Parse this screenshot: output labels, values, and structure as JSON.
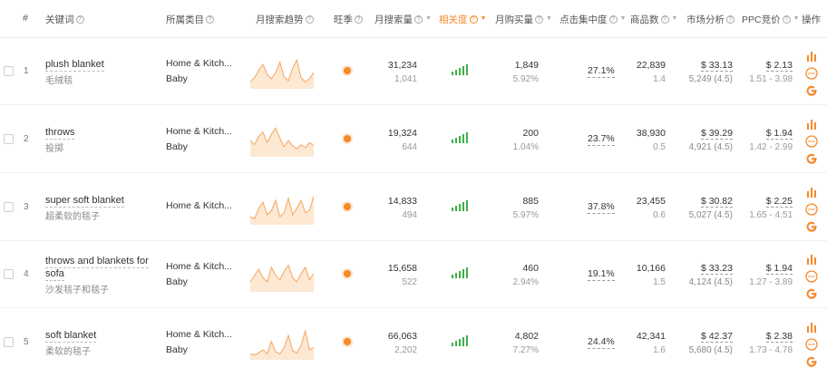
{
  "header": {
    "index": "#",
    "keyword": "关键词",
    "category": "所属类目",
    "trend": "月搜索趋势",
    "peak": "旺季",
    "search_volume": "月搜索量",
    "relevance": "相关度",
    "purchases": "月购买量",
    "click_concentration": "点击集中度",
    "products": "商品数",
    "market": "市场分析",
    "ppc": "PPC竞价",
    "ops": "操作"
  },
  "colors": {
    "accent": "#f5892b",
    "green": "#3db04b",
    "trend_fill": "#fde8d4"
  },
  "icons": {
    "analysis": "bar-chart-icon",
    "more": "ellipsis-circle-icon",
    "google": "google-icon"
  },
  "rows": [
    {
      "index": "1",
      "keyword_en": "plush blanket",
      "keyword_cn": "毛绒毯",
      "category_1": "Home & Kitch...",
      "category_2": "Baby",
      "trend": [
        5,
        9,
        16,
        22,
        12,
        8,
        14,
        24,
        10,
        6,
        18,
        26,
        9,
        5,
        8,
        14
      ],
      "search_volume": "31,234",
      "search_volume_sub": "1,041",
      "relevance_level": 5,
      "purchases": "1,849",
      "purchases_sub": "5.92%",
      "click_concentration": "27.1%",
      "products": "22,839",
      "products_sub": "1.4",
      "price": "$ 33.13",
      "rating": "5,249 (4.5)",
      "ppc": "$ 2.13",
      "ppc_range": "1.51 - 3.98"
    },
    {
      "index": "2",
      "keyword_en": "throws",
      "keyword_cn": "投掷",
      "category_1": "Home & Kitch...",
      "category_2": "Baby",
      "trend": [
        14,
        10,
        18,
        22,
        12,
        20,
        26,
        16,
        8,
        14,
        9,
        6,
        10,
        7,
        12,
        9
      ],
      "search_volume": "19,324",
      "search_volume_sub": "644",
      "relevance_level": 5,
      "purchases": "200",
      "purchases_sub": "1.04%",
      "click_concentration": "23.7%",
      "products": "38,930",
      "products_sub": "0.5",
      "price": "$ 39.29",
      "rating": "4,921 (4.5)",
      "ppc": "$ 1.94",
      "ppc_range": "1.42 - 2.99"
    },
    {
      "index": "3",
      "keyword_en": "super soft blanket",
      "keyword_cn": "超柔软的毯子",
      "category_1": "Home & Kitch...",
      "category_2": "",
      "trend": [
        6,
        4,
        14,
        20,
        8,
        12,
        22,
        6,
        10,
        24,
        8,
        14,
        22,
        10,
        12,
        26
      ],
      "search_volume": "14,833",
      "search_volume_sub": "494",
      "relevance_level": 5,
      "purchases": "885",
      "purchases_sub": "5.97%",
      "click_concentration": "37.8%",
      "products": "23,455",
      "products_sub": "0.6",
      "price": "$ 30.82",
      "rating": "5,027 (4.5)",
      "ppc": "$ 2.25",
      "ppc_range": "1.65 - 4.51"
    },
    {
      "index": "4",
      "keyword_en": "throws and blankets for sofa",
      "keyword_cn": "沙发毯子和毯子",
      "category_1": "Home & Kitch...",
      "category_2": "Baby",
      "trend": [
        8,
        14,
        20,
        12,
        8,
        22,
        14,
        10,
        18,
        24,
        12,
        8,
        16,
        22,
        10,
        16
      ],
      "search_volume": "15,658",
      "search_volume_sub": "522",
      "relevance_level": 5,
      "purchases": "460",
      "purchases_sub": "2.94%",
      "click_concentration": "19.1%",
      "products": "10,166",
      "products_sub": "1.5",
      "price": "$ 33.23",
      "rating": "4,124 (4.5)",
      "ppc": "$ 1.94",
      "ppc_range": "1.27 - 3.89"
    },
    {
      "index": "5",
      "keyword_en": "soft blanket",
      "keyword_cn": "柔软的毯子",
      "category_1": "Home & Kitch...",
      "category_2": "Baby",
      "trend": [
        4,
        3,
        5,
        8,
        4,
        16,
        6,
        4,
        10,
        22,
        7,
        5,
        12,
        26,
        8,
        10
      ],
      "search_volume": "66,063",
      "search_volume_sub": "2,202",
      "relevance_level": 5,
      "purchases": "4,802",
      "purchases_sub": "7.27%",
      "click_concentration": "24.4%",
      "products": "42,341",
      "products_sub": "1.6",
      "price": "$ 42.37",
      "rating": "5,680 (4.5)",
      "ppc": "$ 2.38",
      "ppc_range": "1.73 - 4.78"
    }
  ]
}
